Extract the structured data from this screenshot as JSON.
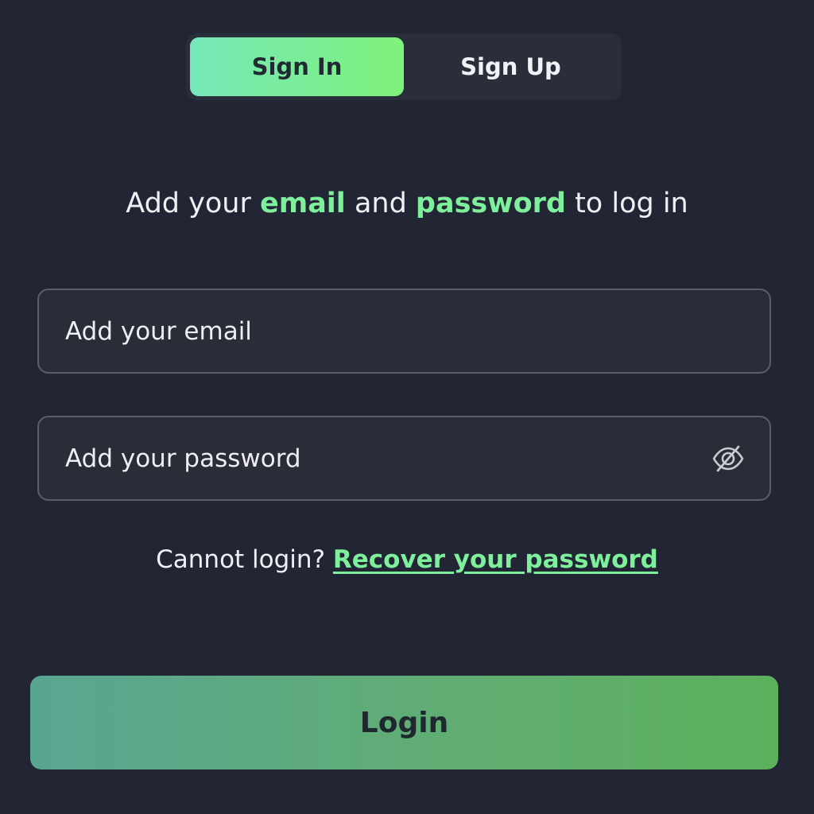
{
  "auth_tabs": {
    "sign_in_label": "Sign In",
    "sign_up_label": "Sign Up",
    "active": "Sign In"
  },
  "subtitle": {
    "part1": "Add your ",
    "email_highlight": "email",
    "part2": " and ",
    "password_highlight": "password",
    "part3": " to log in"
  },
  "email_field": {
    "placeholder": "Add your email",
    "value": ""
  },
  "password_field": {
    "placeholder": "Add your password",
    "value": "",
    "toggle_icon": "eye-off-icon"
  },
  "recover": {
    "prompt": "Cannot login? ",
    "link_label": "Recover your password"
  },
  "login_button": {
    "label": "Login"
  },
  "colors": {
    "background": "#222533",
    "accent": "#7ef09c",
    "field_border": "#5a5e6c"
  }
}
